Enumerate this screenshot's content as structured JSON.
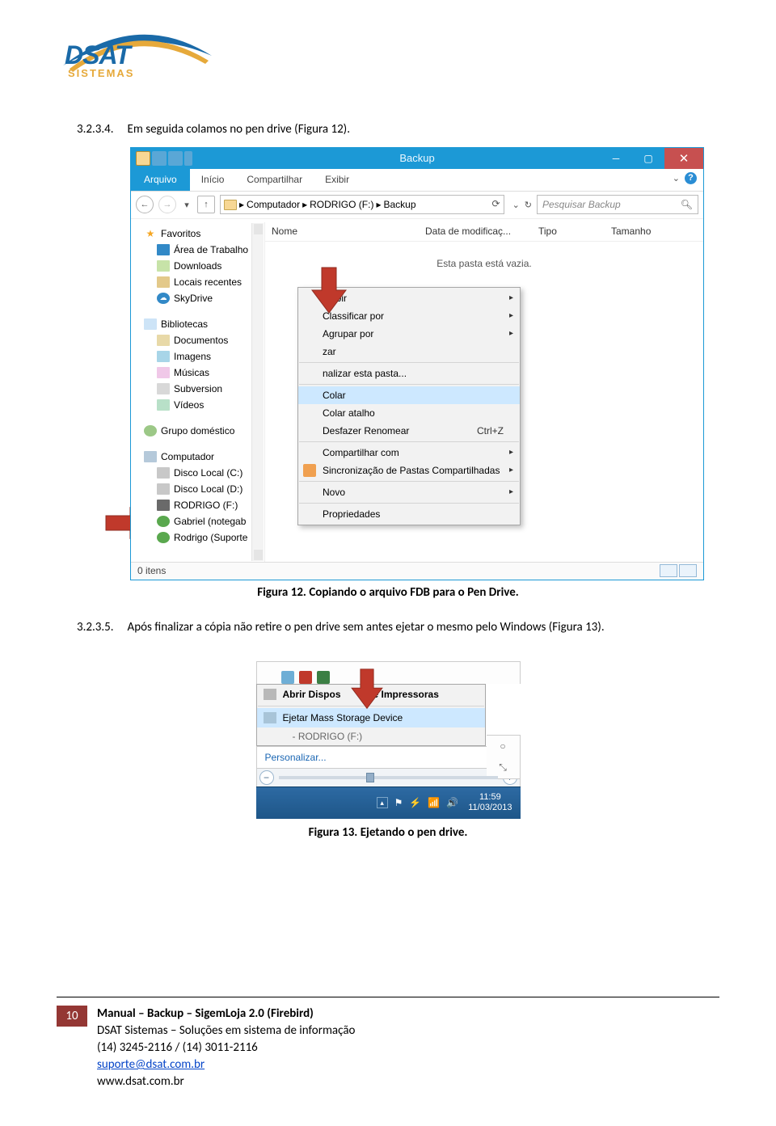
{
  "section1": {
    "num": "3.2.3.4.",
    "text": "Em seguida colamos no pen drive (Figura 12)."
  },
  "caption1": "Figura 12. Copiando o arquivo FDB para o Pen Drive.",
  "section2": {
    "num": "3.2.3.5.",
    "text": "Após finalizar a cópia não retire o pen drive sem antes ejetar o mesmo pelo Windows (Figura 13)."
  },
  "caption2": "Figura 13. Ejetando o pen drive.",
  "logo": {
    "main": "DSAT",
    "sub": "SISTEMAS"
  },
  "explorer": {
    "title": "Backup",
    "ribbon": {
      "file": "Arquivo",
      "home": "Início",
      "share": "Compartilhar",
      "view": "Exibir"
    },
    "breadcrumb": [
      "Computador",
      "RODRIGO (F:)",
      "Backup"
    ],
    "search_placeholder": "Pesquisar Backup",
    "columns": {
      "name": "Nome",
      "date": "Data de modificaç...",
      "type": "Tipo",
      "size": "Tamanho"
    },
    "empty": "Esta pasta está vazia.",
    "status": "0 itens",
    "tree": {
      "favorites": "Favoritos",
      "desktop": "Área de Trabalho",
      "downloads": "Downloads",
      "recent": "Locais recentes",
      "skydrive": "SkyDrive",
      "libraries": "Bibliotecas",
      "documents": "Documentos",
      "pictures": "Imagens",
      "music": "Músicas",
      "subversion": "Subversion",
      "videos": "Vídeos",
      "homegroup": "Grupo doméstico",
      "computer": "Computador",
      "diskC": "Disco Local (C:)",
      "diskD": "Disco Local (D:)",
      "rodrigo": "RODRIGO (F:)",
      "gabriel": "Gabriel (notegab",
      "rsuporte": "Rodrigo (Suporte"
    },
    "context": {
      "exibir": "Exibir",
      "classificar": "Classificar por",
      "agrupar": "Agrupar por",
      "atualizar": "zar",
      "personalizar": "nalizar esta pasta...",
      "colar": "Colar",
      "colar_atalho": "Colar atalho",
      "desfazer": "Desfazer Renomear",
      "desfazer_hk": "Ctrl+Z",
      "compartilhar": "Compartilhar com",
      "sincronizacao": "Sincronização de Pastas Compartilhadas",
      "novo": "Novo",
      "propriedades": "Propriedades"
    }
  },
  "fig13": {
    "abrir": "Abrir Dispos",
    "abrir2": "e Impressoras",
    "ejetar": "Ejetar Mass Storage Device",
    "sub": "-   RODRIGO (F:)",
    "personalizar": "Personalizar...",
    "time": "11:59",
    "date": "11/03/2013"
  },
  "footer": {
    "page": "10",
    "l1a": "Manual – Backup – SigemLoja 2.0 (Firebird)",
    "l2": "DSAT Sistemas – Soluções em sistema de informação",
    "l3": "(14) 3245-2116 / (14) 3011-2116",
    "l4": "suporte@dsat.com.br",
    "l5": "www.dsat.com.br"
  }
}
